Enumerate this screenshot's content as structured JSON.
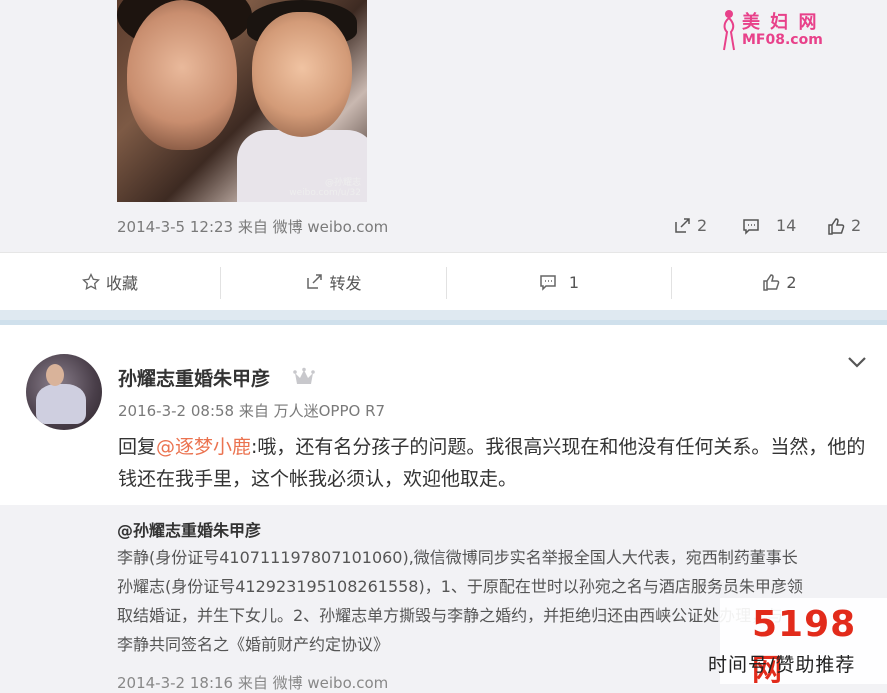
{
  "post1": {
    "image_watermark": "@孙耀志\nweibo.com/u/32",
    "meta": "2014-3-5 12:23 来自 微博 weibo.com",
    "stats": {
      "reposts": "2",
      "comments": "14",
      "likes": "2"
    }
  },
  "site_logo": {
    "line1": "美 妇 网",
    "line2": "MF08.com"
  },
  "actions": {
    "favorite": "收藏",
    "repost": "转发",
    "comment_count": "1",
    "like_count": "2"
  },
  "post2": {
    "author": "孙耀志重婚朱甲彦",
    "meta": "2016-3-2 08:58 来自 万人迷OPPO R7",
    "reply_prefix": "回复",
    "mention": "@逐梦小鹿",
    "text": ":哦，还有名分孩子的问题。我很高兴现在和他没有任何关系。当然，他的钱还在我手里，这个帐我必须认，欢迎他取走。"
  },
  "quoted": {
    "author": "@孙耀志重婚朱甲彦",
    "lines": [
      "李静(身份证号410711197807101060),微信微博同步实名举报全国人大代表，宛西制药董事长",
      "孙耀志(身份证号412923195108261558)，1、于原配在世时以孙宛之名与酒店服务员朱甲彦领",
      "取结婚证，并生下女儿。2、孙耀志单方撕毁与李静之婚约，并拒绝归还由西峡公证处办理，与",
      "李静共同签名之《婚前财产约定协议》"
    ],
    "meta": "2014-3-2 18:16 来自 微博 weibo.com"
  },
  "watermark": {
    "brand": "5198",
    "brand_suffix": "网",
    "tagline": "时间号/赞助推荐"
  },
  "colors": {
    "mention": "#eb7350",
    "logo_pink": "#e8418a",
    "brand_red": "#e22b1b"
  }
}
